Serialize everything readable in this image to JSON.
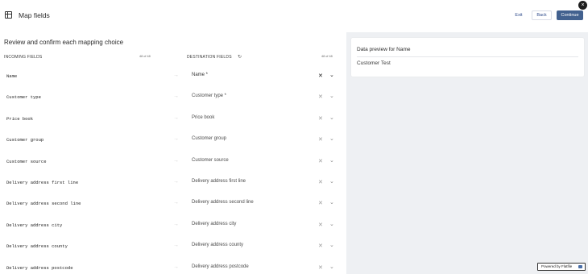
{
  "header": {
    "title": "Map fields",
    "exit_label": "Exit",
    "back_label": "Back",
    "continue_label": "Continue",
    "close_glyph": "×"
  },
  "main": {
    "heading": "Review and confirm each mapping choice",
    "incoming_label": "INCOMING FIELDS",
    "incoming_count": "48 of 48",
    "destination_label": "DESTINATION FIELDS",
    "destination_count": "48 of 48",
    "rows": [
      {
        "source": "Name",
        "destination": "Name *"
      },
      {
        "source": "Customer type",
        "destination": "Customer type *"
      },
      {
        "source": "Price book",
        "destination": "Price book"
      },
      {
        "source": "Customer group",
        "destination": "Customer group"
      },
      {
        "source": "Customer source",
        "destination": "Customer source"
      },
      {
        "source": "Delivery address first line",
        "destination": "Delivery address first line"
      },
      {
        "source": "Delivery address second line",
        "destination": "Delivery address second line"
      },
      {
        "source": "Delivery address city",
        "destination": "Delivery address city"
      },
      {
        "source": "Delivery address county",
        "destination": "Delivery address county"
      },
      {
        "source": "Delivery address postcode",
        "destination": "Delivery address postcode"
      }
    ]
  },
  "preview": {
    "title": "Data preview for Name",
    "value": "Customer Test"
  },
  "footer": {
    "powered_by": "Powered by Flatfile"
  },
  "icons": {
    "grid": "grid-icon",
    "refresh": "refresh-icon",
    "arrow": "arrow-right-icon",
    "clear": "x-icon",
    "chevron": "chevron-down-icon"
  },
  "colors": {
    "accent": "#42618f",
    "panel_bg": "#eef0f3"
  }
}
